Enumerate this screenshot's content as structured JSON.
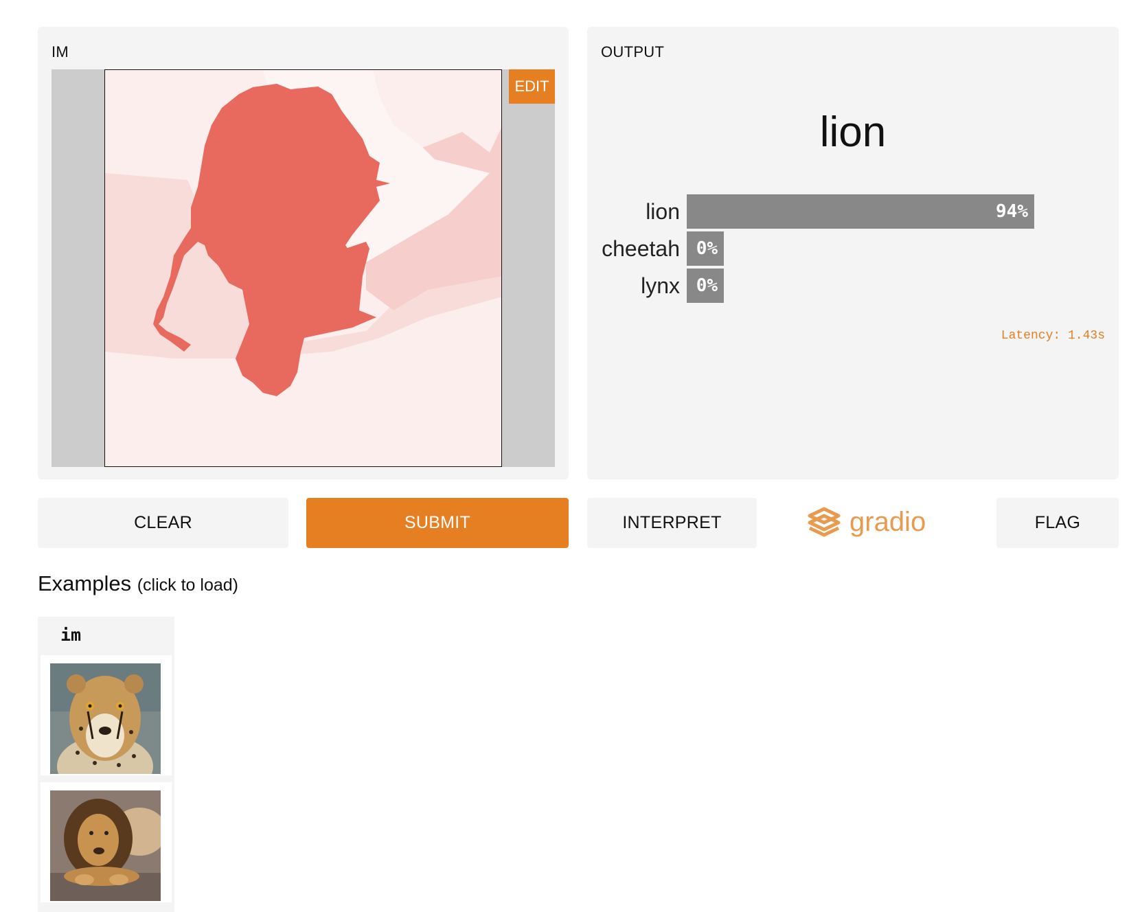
{
  "input": {
    "label": "IM",
    "edit_label": "EDIT"
  },
  "output": {
    "label": "OUTPUT",
    "top_label": "lion",
    "confidences": [
      {
        "label": "lion",
        "value": "94%",
        "fraction": 0.94
      },
      {
        "label": "cheetah",
        "value": "0%",
        "fraction": 0.0
      },
      {
        "label": "lynx",
        "value": "0%",
        "fraction": 0.0
      }
    ],
    "latency": "Latency: 1.43s"
  },
  "buttons": {
    "clear": "CLEAR",
    "submit": "SUBMIT",
    "interpret": "INTERPRET",
    "flag": "FLAG"
  },
  "brand": {
    "name": "gradio"
  },
  "examples": {
    "title": "Examples",
    "hint": "(click to load)",
    "column": "im",
    "items": [
      {
        "icon": "cheetah-thumbnail"
      },
      {
        "icon": "lion-thumbnail"
      }
    ]
  },
  "colors": {
    "accent": "#e67e22",
    "bar": "#888888",
    "panel": "#f4f4f4",
    "saliency": "#e8695e"
  }
}
